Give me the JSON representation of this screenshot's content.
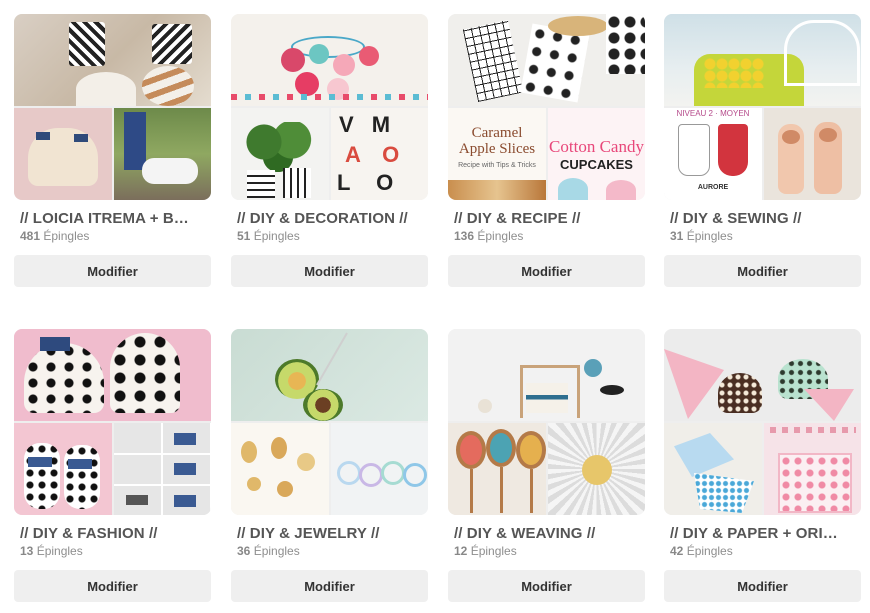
{
  "edit_label": "Modifier",
  "pins_suffix": "Épingles",
  "boards": [
    {
      "title": "// LOICIA ITREMA + B…",
      "count": "481"
    },
    {
      "title": "// DIY & DECORATION //",
      "count": "51"
    },
    {
      "title": "// DIY & RECIPE //",
      "count": "136"
    },
    {
      "title": "// DIY & SEWING //",
      "count": "31"
    },
    {
      "title": "// DIY & FASHION //",
      "count": "13"
    },
    {
      "title": "// DIY & JEWELRY //",
      "count": "36"
    },
    {
      "title": "// DIY & WEAVING //",
      "count": "12"
    },
    {
      "title": "// DIY & PAPER + ORI…",
      "count": "42"
    }
  ],
  "image_text": {
    "caramel_title": "Caramel Apple Slices",
    "caramel_sub": "Recipe with Tips & Tricks",
    "candy_title": "Cotton Candy",
    "candy_sub": "CUPCAKES",
    "sewing_level": "NIVEAU 2 · MOYEN",
    "sewing_name": "AURORE"
  }
}
